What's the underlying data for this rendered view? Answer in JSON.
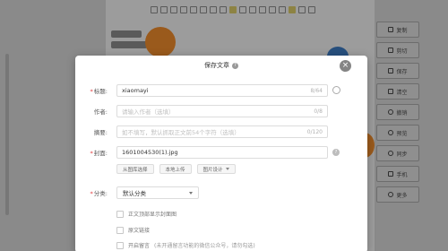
{
  "dialog": {
    "title": "保存文章",
    "close_glyph": "×"
  },
  "form": {
    "title": {
      "label": "标题:",
      "value": "xiaomayi",
      "count": "8/64"
    },
    "author": {
      "label": "作者:",
      "placeholder": "请输入作者（选填）",
      "count": "0/8"
    },
    "summary": {
      "label": "摘要:",
      "placeholder": "如不填写，默认抓取正文前54个字符（选填）",
      "count": "0/120"
    },
    "cover": {
      "label": "封面:",
      "value": "1601004530(1).jpg",
      "buttons": [
        "从图库选择",
        "本地上传",
        "图片设计"
      ]
    },
    "category": {
      "label": "分类:",
      "value": "默认分类"
    },
    "checks": [
      {
        "label": "正文顶部显示封面图"
      },
      {
        "label": "原文链接"
      },
      {
        "label": "开启留言",
        "note": "(未开通留言功能的微信公众号，请勿勾选)"
      }
    ]
  },
  "side_panel": {
    "items": [
      {
        "label": "复制",
        "icon": "copy-icon"
      },
      {
        "label": "剪切",
        "icon": "cut-icon"
      },
      {
        "label": "保存",
        "icon": "save-icon"
      },
      {
        "label": "清空",
        "icon": "trash-icon"
      },
      {
        "label": "撤销",
        "icon": "undo-icon"
      },
      {
        "label": "预览",
        "icon": "eye-icon"
      },
      {
        "label": "同步",
        "icon": "sync-icon"
      },
      {
        "label": "手机",
        "icon": "phone-icon"
      },
      {
        "label": "更多",
        "icon": "more-icon"
      }
    ]
  },
  "colors": {
    "required": "#e4393c",
    "overlay": "#7b7b7b",
    "dialog_bg": "#ffffff"
  }
}
